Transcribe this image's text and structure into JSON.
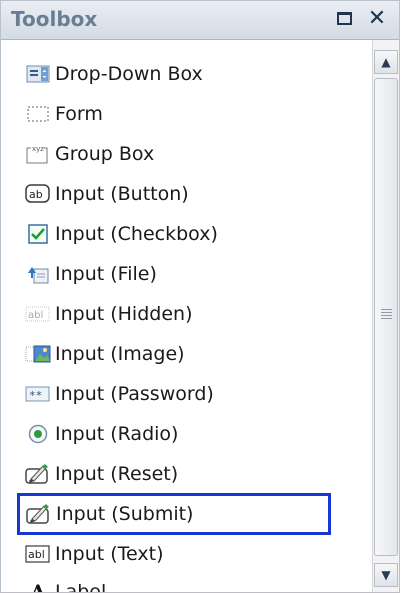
{
  "toolbox": {
    "title": "Toolbox",
    "items": [
      {
        "label": "Drop-Down Box",
        "icon": "dropdown-box-icon"
      },
      {
        "label": "Form",
        "icon": "form-icon"
      },
      {
        "label": "Group Box",
        "icon": "group-box-icon"
      },
      {
        "label": "Input (Button)",
        "icon": "input-button-icon"
      },
      {
        "label": "Input (Checkbox)",
        "icon": "checkbox-icon"
      },
      {
        "label": "Input (File)",
        "icon": "file-icon"
      },
      {
        "label": "Input (Hidden)",
        "icon": "hidden-input-icon"
      },
      {
        "label": "Input (Image)",
        "icon": "image-input-icon"
      },
      {
        "label": "Input (Password)",
        "icon": "password-icon"
      },
      {
        "label": "Input (Radio)",
        "icon": "radio-icon"
      },
      {
        "label": "Input (Reset)",
        "icon": "reset-icon"
      },
      {
        "label": "Input (Submit)",
        "icon": "submit-icon"
      },
      {
        "label": "Input (Text)",
        "icon": "text-input-icon"
      },
      {
        "label": "Label",
        "icon": "label-icon"
      }
    ],
    "selected_item": "Input (Submit)",
    "icon_labels": {
      "group_box": "xyz",
      "input_button": "ab",
      "hidden": "abl",
      "text": "abl",
      "password": "**",
      "label": "A"
    }
  },
  "colors": {
    "selection_border": "#1736d6",
    "title_text": "#6a7e93"
  }
}
